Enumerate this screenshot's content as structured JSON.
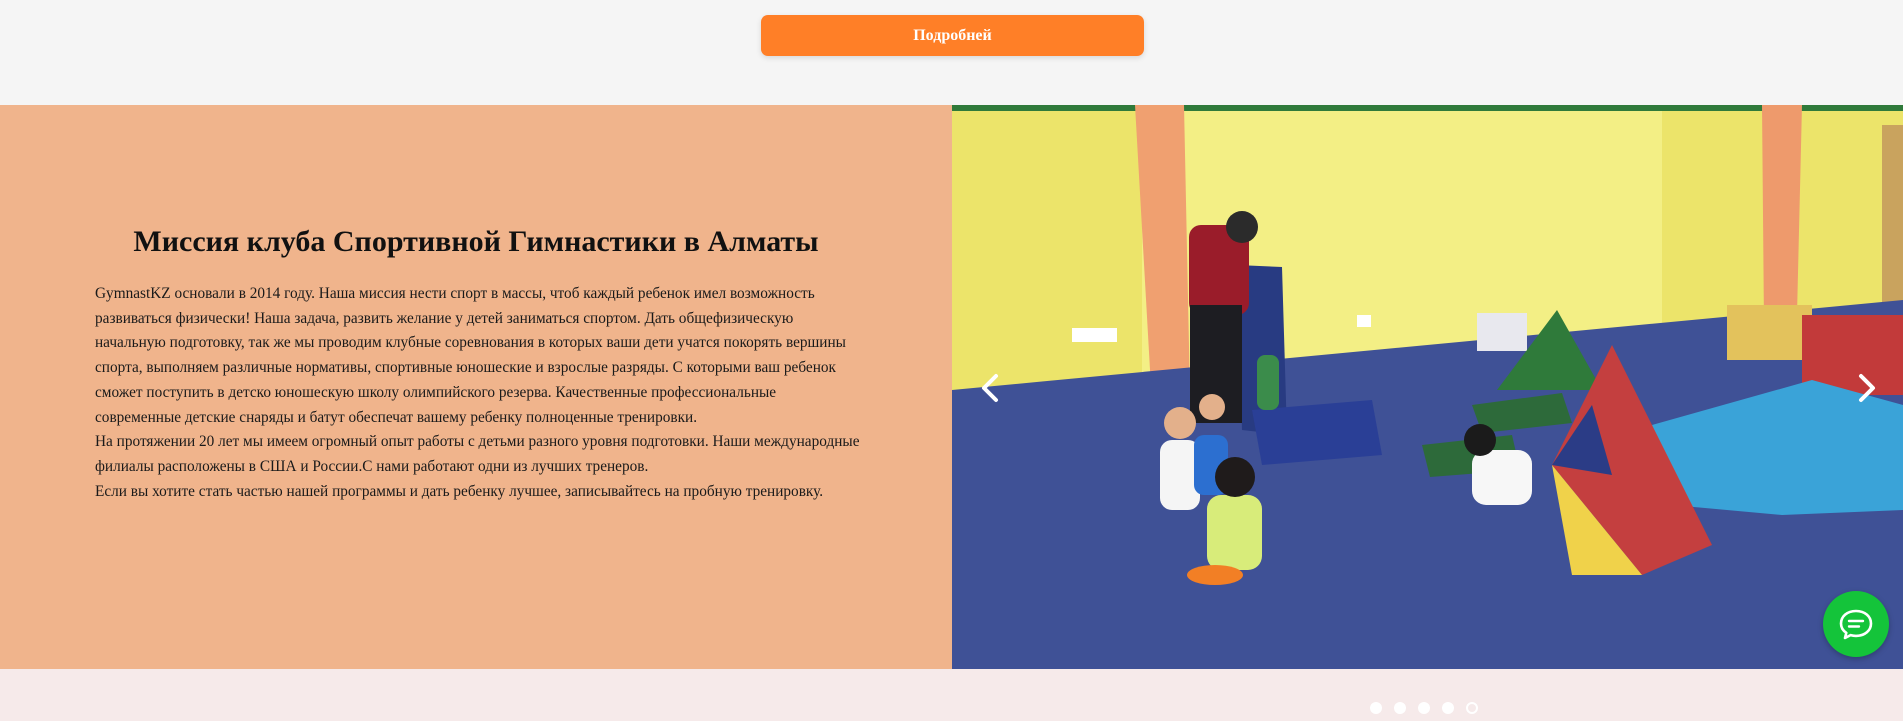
{
  "cta": {
    "more_label": "Подробней"
  },
  "mission": {
    "title": "Миссия клуба Спортивной Гимнастики в Алматы",
    "paragraphs": [
      "GymnastKZ основали в 2014 году. Наша миссия нести спорт в массы, чтоб каждый ребенок имел возможность развиваться физически! Наша задача, развить желание у детей заниматься спортом. Дать общефизическую начальную подготовку, так же мы проводим клубные соревнования в которых ваши дети учатся покорять вершины спорта, выполняем различные нормативы, спортивные юношеские и взрослые разряды. С которыми ваш ребенок сможет поступить в детско юношескую школу олимпийского резерва. Качественные профессиональные современные детские снаряды и батут обеспечат вашему ребенку полноценные тренировки.",
      "На протяжении 20 лет мы имеем огромный опыт работы с детьми разного уровня подготовки. Наши международные филиалы расположены в США и России.С нами работают одни из лучших тренеров.",
      "Если вы хотите стать частью нашей программы и дать ребенку лучшее, записывайтесь на пробную тренировку."
    ]
  },
  "slider": {
    "total_slides": 5,
    "active_slide": 5,
    "prev_icon": "chevron-left-icon",
    "next_icon": "chevron-right-icon"
  },
  "chat": {
    "icon": "chat-bubble-icon",
    "color": "#14c43a"
  },
  "colors": {
    "accent": "#ff7f27",
    "mission_bg": "#f0b48c",
    "page_bg": "#f5f5f5"
  }
}
